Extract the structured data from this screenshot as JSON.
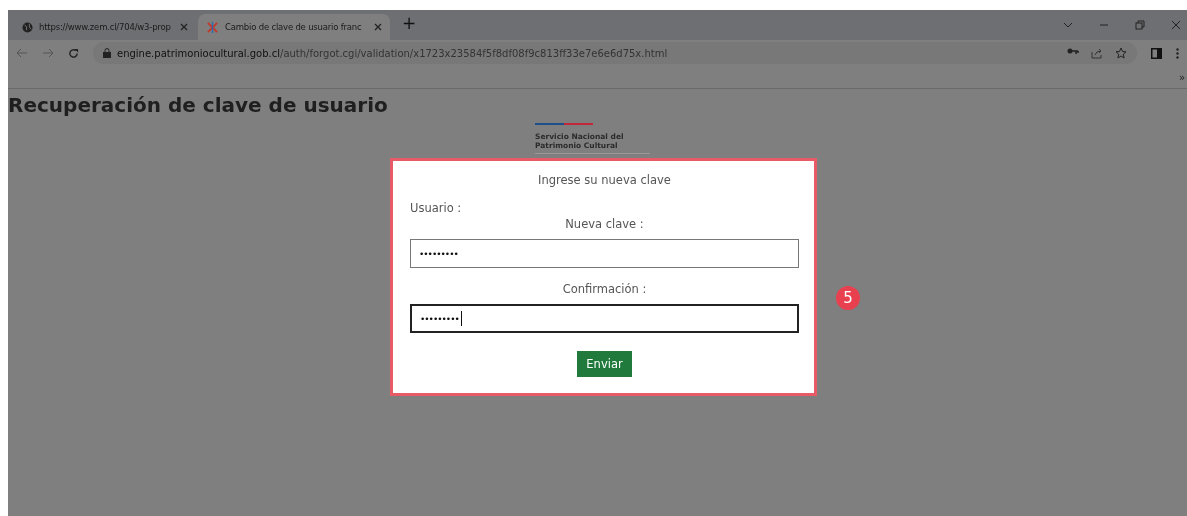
{
  "browser": {
    "tabs": [
      {
        "title": "https://www.zem.cl/704/w3-prop",
        "selected": false
      },
      {
        "title": "Cambio de clave de usuario franc",
        "selected": true
      }
    ],
    "new_tab": "+",
    "address": {
      "domain": "engine.patrimoniocultural.gob.cl",
      "path": "/auth/forgot.cgi/validation/x1723x23584f5f8df08f9c813ff33e7e6e6d75x.html"
    },
    "bookmarks_more": "»"
  },
  "page": {
    "heading": "Recuperación de clave de usuario",
    "logo": {
      "line1": "Servicio Nacional del",
      "line2": "Patrimonio Cultural"
    },
    "form": {
      "title": "Ingrese su nueva clave",
      "user_label": "Usuario :",
      "fields": [
        {
          "label": "Nueva clave :",
          "value": "•••••••••",
          "focused": false
        },
        {
          "label": "Confirmación :",
          "value": "•••••••••",
          "focused": true
        }
      ],
      "submit": "Enviar"
    }
  },
  "step_badge": "5"
}
